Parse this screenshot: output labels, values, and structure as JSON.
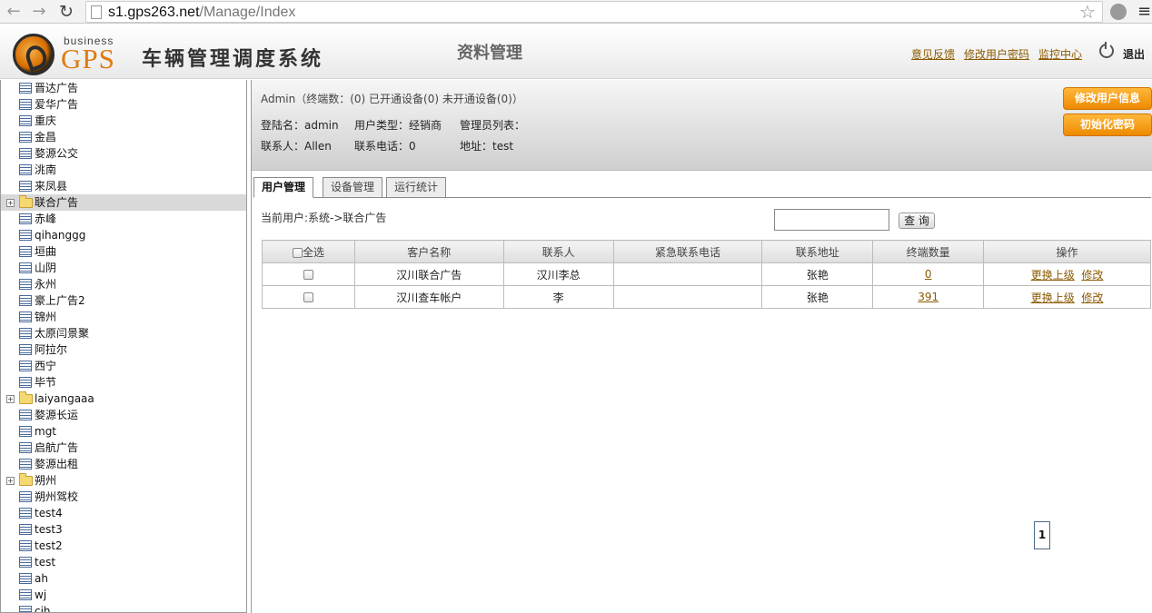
{
  "browser": {
    "url_host": "s1.gps263.net",
    "url_path": "/Manage/Index"
  },
  "header": {
    "logo_small": "business",
    "logo_big": "GPS",
    "system_title": "车辆管理调度系统",
    "section_title": "资料管理",
    "links": [
      "意见反馈",
      "修改用户密码",
      "监控中心"
    ],
    "logout": "退出"
  },
  "sidebar": {
    "items": [
      {
        "label": "晋达广告",
        "type": "doc"
      },
      {
        "label": "爱华广告",
        "type": "doc"
      },
      {
        "label": "重庆",
        "type": "doc"
      },
      {
        "label": "金昌",
        "type": "doc"
      },
      {
        "label": "婺源公交",
        "type": "doc"
      },
      {
        "label": "洮南",
        "type": "doc"
      },
      {
        "label": "来凤县",
        "type": "doc"
      },
      {
        "label": "联合广告",
        "type": "folder"
      },
      {
        "label": "赤峰",
        "type": "doc"
      },
      {
        "label": "qihanggg",
        "type": "doc"
      },
      {
        "label": "垣曲",
        "type": "doc"
      },
      {
        "label": "山阴",
        "type": "doc"
      },
      {
        "label": "永州",
        "type": "doc"
      },
      {
        "label": "豪上广告2",
        "type": "doc"
      },
      {
        "label": "锦州",
        "type": "doc"
      },
      {
        "label": "太原闫景聚",
        "type": "doc"
      },
      {
        "label": "阿拉尔",
        "type": "doc"
      },
      {
        "label": "西宁",
        "type": "doc"
      },
      {
        "label": "毕节",
        "type": "doc"
      },
      {
        "label": "laiyangaaa",
        "type": "folder"
      },
      {
        "label": "婺源长运",
        "type": "doc"
      },
      {
        "label": "mgt",
        "type": "doc"
      },
      {
        "label": "启航广告",
        "type": "doc"
      },
      {
        "label": "婺源出租",
        "type": "doc"
      },
      {
        "label": "朔州",
        "type": "folder"
      },
      {
        "label": "朔州驾校",
        "type": "doc"
      },
      {
        "label": "test4",
        "type": "doc"
      },
      {
        "label": "test3",
        "type": "doc"
      },
      {
        "label": "test2",
        "type": "doc"
      },
      {
        "label": "test",
        "type": "doc"
      },
      {
        "label": "ah",
        "type": "doc"
      },
      {
        "label": "wj",
        "type": "doc"
      },
      {
        "label": "cjh",
        "type": "doc"
      }
    ]
  },
  "info": {
    "summary": "Admin（终端数：(0)  已开通设备(0)  未开通设备(0)）",
    "login_name": "登陆名：admin",
    "user_type": "用户类型：经销商",
    "admin_list": "管理员列表：",
    "contact": "联系人：Allen",
    "phone": "联系电话：0",
    "address": "地址：test",
    "btn_edit_info": "修改用户信息",
    "btn_reset_pwd": "初始化密码"
  },
  "tabs": [
    "用户管理",
    "设备管理",
    "运行统计"
  ],
  "current_user": "当前用户:系统->联合广告",
  "search": {
    "placeholder": "",
    "button": "查 询"
  },
  "table": {
    "headers": [
      "全选",
      "客户名称",
      "联系人",
      "紧急联系电话",
      "联系地址",
      "终端数量",
      "操作"
    ],
    "rows": [
      {
        "name": "汉川联合广告",
        "contact": "汉川李总",
        "phone": "",
        "address": "张艳",
        "terminals": "0",
        "action1": "更换上级",
        "action2": "修改"
      },
      {
        "name": "汉川查车帐户",
        "contact": "李",
        "phone": "",
        "address": "张艳",
        "terminals": "391",
        "action1": "更换上级",
        "action2": "修改"
      }
    ]
  },
  "pager": {
    "page": "1"
  }
}
